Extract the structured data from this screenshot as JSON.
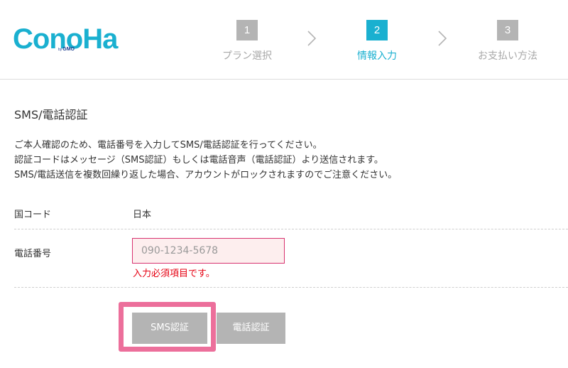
{
  "header": {
    "logo": {
      "name": "ConoHa",
      "by": "by",
      "brand": "GMO"
    },
    "steps": [
      {
        "num": "1",
        "label": "プラン選択"
      },
      {
        "num": "2",
        "label": "情報入力"
      },
      {
        "num": "3",
        "label": "お支払い方法"
      }
    ],
    "active_step": 2
  },
  "section": {
    "title": "SMS/電話認証",
    "description": [
      "ご本人確認のため、電話番号を入力してSMS/電話認証を行ってください。",
      "認証コードはメッセージ（SMS認証）もしくは電話音声（電話認証）より送信されます。",
      "SMS/電話送信を複数回繰り返した場合、アカウントがロックされますのでご注意ください。"
    ]
  },
  "form": {
    "country": {
      "label": "国コード",
      "value": "日本"
    },
    "phone": {
      "label": "電話番号",
      "placeholder": "090-1234-5678",
      "value": "",
      "error": "入力必須項目です。"
    }
  },
  "buttons": {
    "sms": "SMS認証",
    "tel": "電話認証"
  },
  "colors": {
    "accent": "#1ab0d0",
    "inactive": "#b4b4b4",
    "error": "#e60012",
    "highlight": "#ec6f9b"
  }
}
